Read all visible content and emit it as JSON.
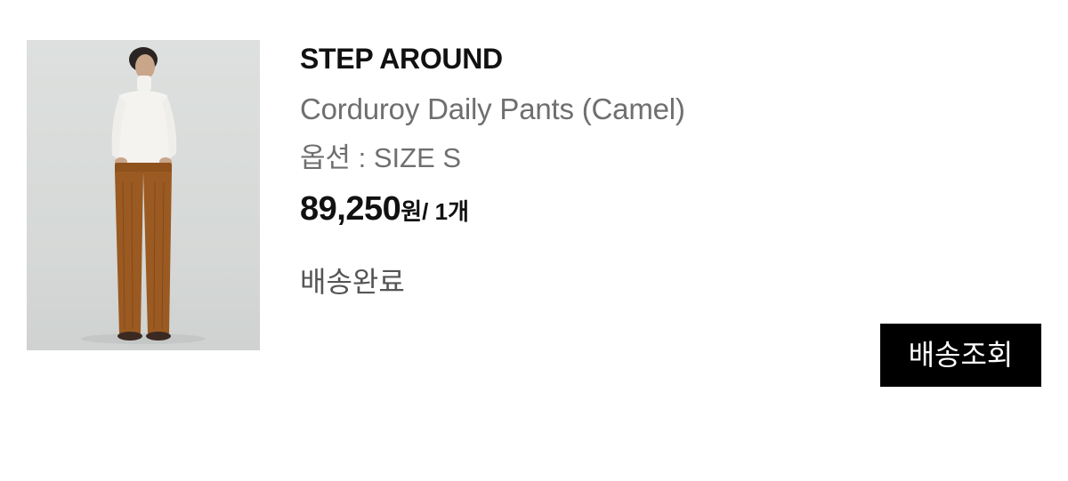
{
  "order_item": {
    "image_icon": "product-photo-model-in-white-turtleneck-and-camel-corduroy-pants",
    "brand": "STEP AROUND",
    "product_name": "Corduroy Daily Pants (Camel)",
    "option": "옵션 : SIZE S",
    "price": "89,250",
    "currency": "원",
    "quantity": "/ 1개",
    "status": "배송완료",
    "track_button_label": "배송조회"
  },
  "colors": {
    "button_bg": "#000000",
    "button_text": "#ffffff",
    "secondary_text": "#6f6f6f",
    "pants_color": "#9a5a22"
  }
}
